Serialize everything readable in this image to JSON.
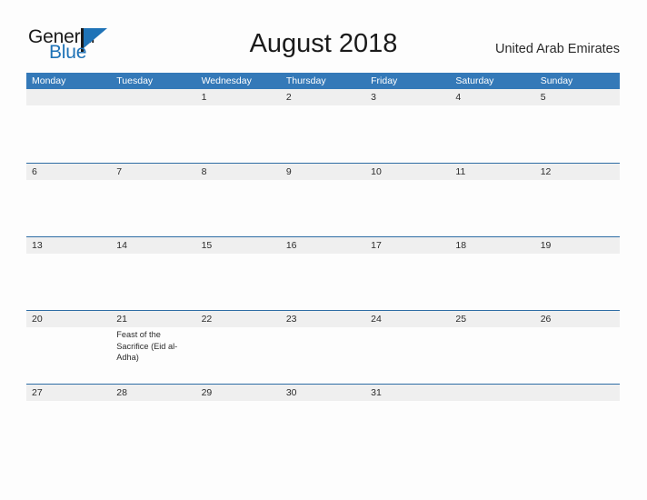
{
  "brand": {
    "name_part1": "General",
    "name_part2": "Blue",
    "flag_icon": "flag-icon",
    "accent_color": "#1f73b7"
  },
  "header": {
    "title": "August 2018",
    "country": "United Arab Emirates"
  },
  "colors": {
    "header_blue": "#3479b8",
    "row_rule_blue": "#2e6da4",
    "band_gray": "#efefef",
    "page_background": "#fdfdfd",
    "text": "#2b2b2b"
  },
  "calendar": {
    "month": "August",
    "year": "2018",
    "week_start": "Monday",
    "weekdays": [
      "Monday",
      "Tuesday",
      "Wednesday",
      "Thursday",
      "Friday",
      "Saturday",
      "Sunday"
    ],
    "weeks": [
      [
        {
          "date": "",
          "event": ""
        },
        {
          "date": "",
          "event": ""
        },
        {
          "date": "1",
          "event": ""
        },
        {
          "date": "2",
          "event": ""
        },
        {
          "date": "3",
          "event": ""
        },
        {
          "date": "4",
          "event": ""
        },
        {
          "date": "5",
          "event": ""
        }
      ],
      [
        {
          "date": "6",
          "event": ""
        },
        {
          "date": "7",
          "event": ""
        },
        {
          "date": "8",
          "event": ""
        },
        {
          "date": "9",
          "event": ""
        },
        {
          "date": "10",
          "event": ""
        },
        {
          "date": "11",
          "event": ""
        },
        {
          "date": "12",
          "event": ""
        }
      ],
      [
        {
          "date": "13",
          "event": ""
        },
        {
          "date": "14",
          "event": ""
        },
        {
          "date": "15",
          "event": ""
        },
        {
          "date": "16",
          "event": ""
        },
        {
          "date": "17",
          "event": ""
        },
        {
          "date": "18",
          "event": ""
        },
        {
          "date": "19",
          "event": ""
        }
      ],
      [
        {
          "date": "20",
          "event": ""
        },
        {
          "date": "21",
          "event": "Feast of the Sacrifice (Eid al-Adha)"
        },
        {
          "date": "22",
          "event": ""
        },
        {
          "date": "23",
          "event": ""
        },
        {
          "date": "24",
          "event": ""
        },
        {
          "date": "25",
          "event": ""
        },
        {
          "date": "26",
          "event": ""
        }
      ],
      [
        {
          "date": "27",
          "event": ""
        },
        {
          "date": "28",
          "event": ""
        },
        {
          "date": "29",
          "event": ""
        },
        {
          "date": "30",
          "event": ""
        },
        {
          "date": "31",
          "event": ""
        },
        {
          "date": "",
          "event": ""
        },
        {
          "date": "",
          "event": ""
        }
      ]
    ]
  }
}
